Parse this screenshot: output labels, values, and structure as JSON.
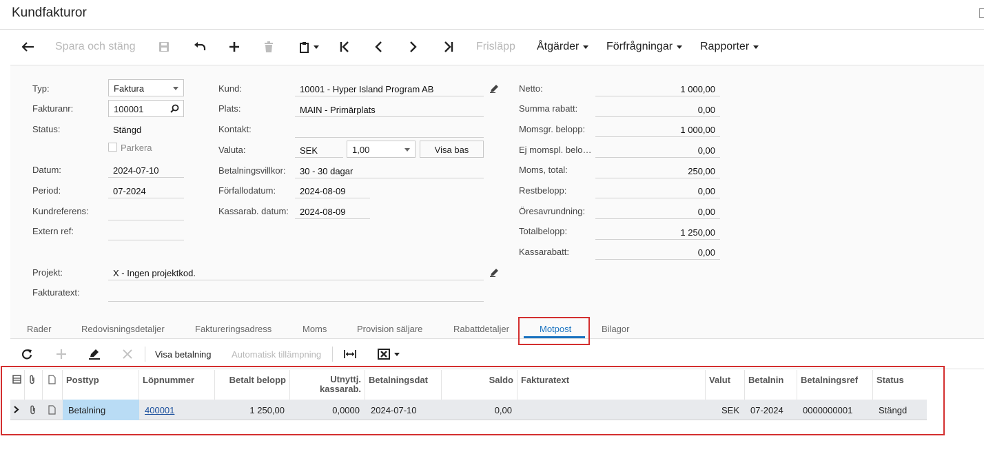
{
  "page": {
    "title": "Kundfakturor"
  },
  "toolbar": {
    "save_close": "Spara och stäng",
    "release": "Frisläpp",
    "actions": "Åtgärder",
    "inquiries": "Förfrågningar",
    "reports": "Rapporter"
  },
  "form": {
    "type_label": "Typ:",
    "type_value": "Faktura",
    "invoice_no_label": "Fakturanr:",
    "invoice_no_value": "100001",
    "status_label": "Status:",
    "status_value": "Stängd",
    "hold_label": "Parkera",
    "date_label": "Datum:",
    "date_value": "2024-07-10",
    "period_label": "Period:",
    "period_value": "07-2024",
    "cust_ref_label": "Kundreferens:",
    "cust_ref_value": "",
    "ext_ref_label": "Extern ref:",
    "ext_ref_value": "",
    "customer_label": "Kund:",
    "customer_value": "10001 - Hyper Island Program AB",
    "location_label": "Plats:",
    "location_value": "MAIN - Primärplats",
    "contact_label": "Kontakt:",
    "contact_value": "",
    "currency_label": "Valuta:",
    "currency_value": "SEK",
    "rate_value": "1,00",
    "view_base": "Visa bas",
    "terms_label": "Betalningsvillkor:",
    "terms_value": "30 - 30 dagar",
    "due_label": "Förfallodatum:",
    "due_value": "2024-08-09",
    "cashdisc_date_label": "Kassarab. datum:",
    "cashdisc_date_value": "2024-08-09",
    "project_label": "Projekt:",
    "project_value": "X - Ingen projektkod.",
    "invoice_text_label": "Fakturatext:",
    "invoice_text_value": ""
  },
  "summary": {
    "net_label": "Netto:",
    "net_value": "1 000,00",
    "discount_label": "Summa rabatt:",
    "discount_value": "0,00",
    "taxable_label": "Momsgr. belopp:",
    "taxable_value": "1 000,00",
    "exempt_label": "Ej momspl. belo…",
    "exempt_value": "0,00",
    "vat_label": "Moms, total:",
    "vat_value": "250,00",
    "balance_label": "Restbelopp:",
    "balance_value": "0,00",
    "rounding_label": "Öresavrundning:",
    "rounding_value": "0,00",
    "total_label": "Totalbelopp:",
    "total_value": "1 250,00",
    "cashdisc_label": "Kassarabatt:",
    "cashdisc_value": "0,00"
  },
  "tabs": [
    {
      "label": "Rader"
    },
    {
      "label": "Redovisningsdetaljer"
    },
    {
      "label": "Faktureringsadress"
    },
    {
      "label": "Moms"
    },
    {
      "label": "Provision säljare"
    },
    {
      "label": "Rabattdetaljer"
    },
    {
      "label": "Motpost"
    },
    {
      "label": "Bilagor"
    }
  ],
  "active_tab": "Motpost",
  "grid_toolbar": {
    "view_payment": "Visa betalning",
    "auto_apply": "Automatisk tillämpning"
  },
  "grid": {
    "headers": {
      "doc_type": "Posttyp",
      "ref_nbr": "Löpnummer",
      "amount_paid": "Betalt belopp",
      "cash_disc": "Utnyttj. kassarab.",
      "pay_date": "Betalningsdat",
      "balance": "Saldo",
      "desc": "Fakturatext",
      "currency": "Valut",
      "period": "Betalnin",
      "pay_ref": "Betalningsref",
      "status": "Status"
    },
    "rows": [
      {
        "doc_type": "Betalning",
        "ref_nbr": "400001",
        "amount_paid": "1 250,00",
        "cash_disc": "0,0000",
        "pay_date": "2024-07-10",
        "balance": "0,00",
        "desc": "",
        "currency": "SEK",
        "period": "07-2024",
        "pay_ref": "0000000001",
        "status": "Stängd"
      }
    ]
  },
  "colors": {
    "accent": "#1a73c0",
    "highlight": "#d32f2f",
    "selected_cell": "#b9dcf5"
  }
}
